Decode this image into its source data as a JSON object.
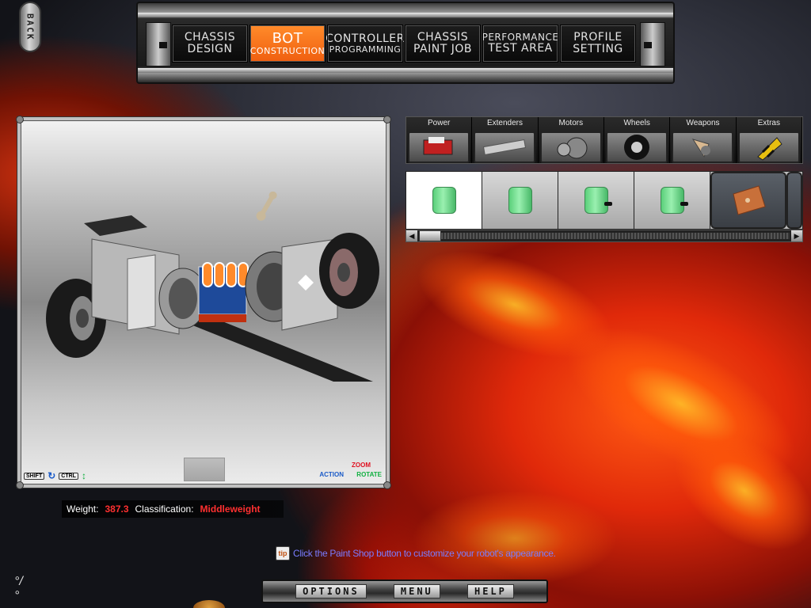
{
  "back": {
    "label": "BACK"
  },
  "nav": {
    "tabs": [
      {
        "line1": "CHASSIS",
        "line2": "DESIGN",
        "active": false
      },
      {
        "line1": "BOT",
        "line2": "CONSTRUCTION",
        "active": true
      },
      {
        "line1": "CONTROLLER",
        "line2": "PROGRAMMING",
        "active": false
      },
      {
        "line1": "CHASSIS",
        "line2": "PAINT JOB",
        "active": false
      },
      {
        "line1": "PERFORMANCE",
        "line2": "TEST AREA",
        "active": false
      },
      {
        "line1": "PROFILE",
        "line2": "SETTING",
        "active": false
      }
    ]
  },
  "viewport": {
    "shift_key": "SHIFT",
    "ctrl_key": "CTRL",
    "zoom_label": "ZOOM",
    "action_label": "ACTION",
    "rotate_label": "ROTATE"
  },
  "status": {
    "weight_label": "Weight:",
    "weight_value": "387.3",
    "class_label": "Classification:",
    "class_value": "Middleweight"
  },
  "categories": [
    {
      "name": "Power",
      "icon": "battery-pack-icon"
    },
    {
      "name": "Extenders",
      "icon": "extender-bar-icon"
    },
    {
      "name": "Motors",
      "icon": "motor-icon"
    },
    {
      "name": "Wheels",
      "icon": "wheel-icon"
    },
    {
      "name": "Weapons",
      "icon": "weapon-icon"
    },
    {
      "name": "Extras",
      "icon": "extras-icon"
    }
  ],
  "items": [
    {
      "icon": "battery-icon",
      "selected": true
    },
    {
      "icon": "battery-icon",
      "selected": false
    },
    {
      "icon": "battery-icon",
      "selected": false
    },
    {
      "icon": "battery-icon",
      "selected": false
    },
    {
      "icon": "circuit-board-icon",
      "selected": false
    }
  ],
  "tip": {
    "icon_label": "tip",
    "text": "Click the Paint Shop button to customize your robot's appearance."
  },
  "bottom": {
    "options": "OPTIONS",
    "menu": "MENU",
    "help": "HELP"
  },
  "colors": {
    "accent": "#f06010",
    "status_value": "#ff3030",
    "tip_text": "#7a7cff"
  }
}
